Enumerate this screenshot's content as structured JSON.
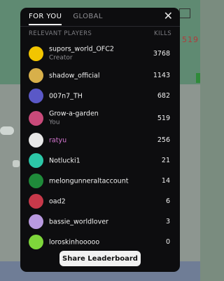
{
  "tabs": [
    {
      "label": "FOR YOU",
      "active": true
    },
    {
      "label": "GLOBAL",
      "active": false
    }
  ],
  "header": {
    "players": "RELEVANT PLAYERS",
    "kills": "KILLS"
  },
  "players": [
    {
      "name": "supors_world_OFC2",
      "subtitle": "Creator",
      "kills": "3768",
      "avatar_color": "#f2c500"
    },
    {
      "name": "shadow_official",
      "subtitle": "",
      "kills": "1143",
      "avatar_color": "#d8b04a"
    },
    {
      "name": "007n7_TH",
      "subtitle": "",
      "kills": "682",
      "avatar_color": "#5a58c7"
    },
    {
      "name": "Grow-a-garden",
      "subtitle": "You",
      "kills": "519",
      "avatar_color": "#c94a7a"
    },
    {
      "name": "ratyu",
      "subtitle": "",
      "kills": "256",
      "avatar_color": "#e8e8e8"
    },
    {
      "name": "Notlucki1",
      "subtitle": "",
      "kills": "21",
      "avatar_color": "#2cc7a7"
    },
    {
      "name": "melongunneraltaccount",
      "subtitle": "",
      "kills": "14",
      "avatar_color": "#1f8a3a"
    },
    {
      "name": "oad2",
      "subtitle": "",
      "kills": "6",
      "avatar_color": "#c8394a"
    },
    {
      "name": "bassie_worldlover",
      "subtitle": "",
      "kills": "3",
      "avatar_color": "#b99ae0"
    },
    {
      "name": "loroskinhooooo",
      "subtitle": "",
      "kills": "0",
      "avatar_color": "#7ed63b"
    }
  ],
  "share_label": "Share Leaderboard",
  "background_text": "519"
}
